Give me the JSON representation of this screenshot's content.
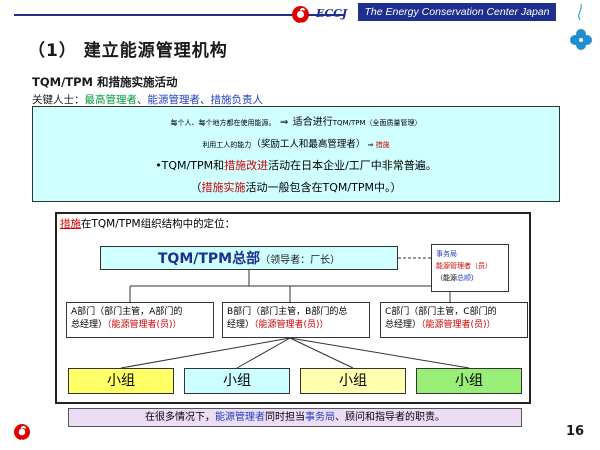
{
  "header": {
    "org_abbr": "ECCJ",
    "org_name": "The Energy Conservation Center Japan"
  },
  "title": "（1）  建立能源管理机构",
  "subtitle": "TQM/TPM 和措施实施活动",
  "key_people": {
    "label": "关键人士：",
    "p1": "最高管理者",
    "sep1": "、",
    "p2": "能源管理者",
    "sep2": "、",
    "p3": "措施负责人"
  },
  "infobox": {
    "l1_a": "每个人、每个地方都在使用能源。",
    "l1_arrow": "⇒",
    "l1_b": "适合进行",
    "l1_c": "TQM/TPM（全面质量管理）",
    "l2_a": "利用工人的能力",
    "l2_b": "（奖励工人和最高管理者）",
    "l2_arrow": "⇒",
    "l2_c": "措施",
    "l3_a": "•TQM/TPM和",
    "l3_b": "措施改进",
    "l3_c": "活动在日本企业/工厂中非常普遍。",
    "l4_a": "（",
    "l4_b": "措施实施",
    "l4_c": "活动一般包含在TQM/TPM中。）"
  },
  "org": {
    "title_a": "措施",
    "title_b": "在TQM/TPM组织结构中的定位：",
    "hq_main": "TQM/TPM总部",
    "hq_sub": "（领导者：厂长）",
    "sec_l1": "事务局",
    "sec_l2": "能源管理者（员）",
    "sec_l3a": "（能源",
    "sec_l3b": "总顺",
    "sec_l3c": "）",
    "depts": [
      {
        "l1": "A部门（部门主管，A部门的",
        "l2a": "总经理）",
        "l2b": "（能源管理者(员)）"
      },
      {
        "l1": "B部门（部门主管，B部门的总",
        "l2a": "经理）",
        "l2b": "（能源管理者(员)）"
      },
      {
        "l1": "C部门（部门主管，C部门的",
        "l2a": "总经理）",
        "l2b": "（能源管理者(员)）"
      }
    ],
    "groups": [
      "小组",
      "小组",
      "小组",
      "小组"
    ]
  },
  "footer": {
    "a": "在很多情况下，",
    "b": "能源管理者",
    "c": "同时担当",
    "d": "事务局",
    "e": "、顾问和指导者的职责。"
  },
  "page_number": "16",
  "colors": {
    "navy": "#1f2f8f",
    "red": "#d00000",
    "green": "#009a3e",
    "blue": "#1f3fbf",
    "cyan_box": "#cfffff",
    "group_yellow": "#ffff66",
    "group_cyan": "#ccffff",
    "group_lightyellow": "#ffffb0",
    "group_green": "#99ee77",
    "footer_lavender": "#ecdcf5"
  }
}
